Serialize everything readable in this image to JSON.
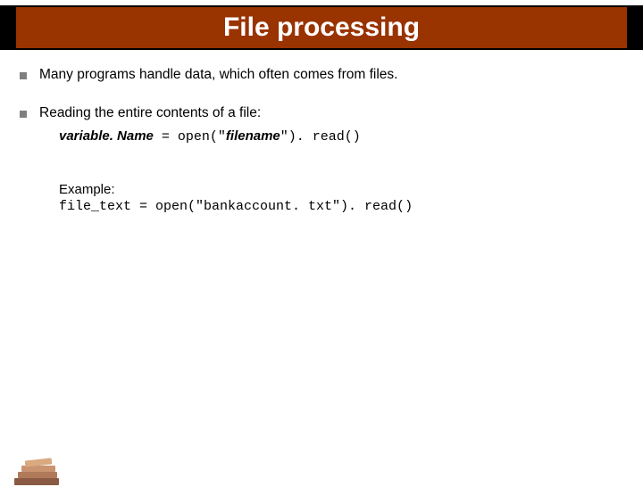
{
  "title": "File processing",
  "bullets": {
    "b1": "Many programs handle data, which often comes from files.",
    "b2": "Reading the entire contents of a file:"
  },
  "syntax": {
    "varname": "variable. Name",
    "eq_open": " = open(\"",
    "filename": "filename",
    "close_read": "\"). read()"
  },
  "example": {
    "label": "Example:",
    "code": "file_text = open(\"bankaccount. txt\"). read()"
  }
}
